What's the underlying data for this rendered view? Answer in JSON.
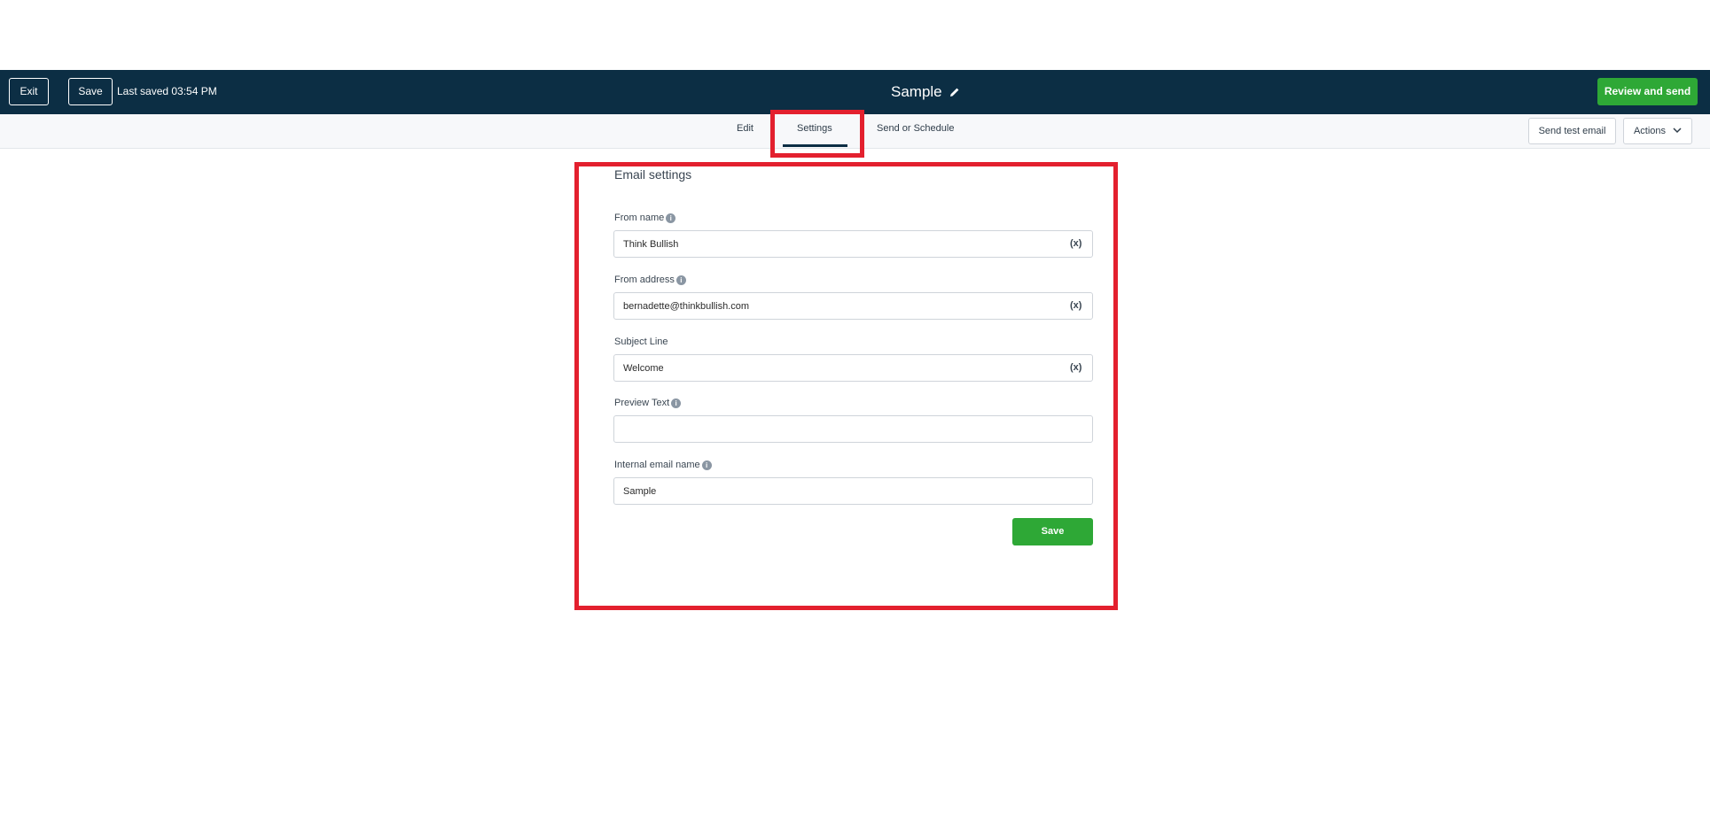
{
  "header": {
    "exit_label": "Exit",
    "save_label": "Save",
    "last_saved": "Last saved 03:54 PM",
    "title": "Sample",
    "review_label": "Review and send"
  },
  "tabs": [
    {
      "label": "Edit"
    },
    {
      "label": "Settings"
    },
    {
      "label": "Send or Schedule"
    }
  ],
  "toolbar": {
    "send_test_label": "Send test email",
    "actions_label": "Actions"
  },
  "settings": {
    "title": "Email settings",
    "from_name": {
      "label": "From name",
      "value": "Think Bullish"
    },
    "from_address": {
      "label": "From address",
      "value": "bernadette@thinkbullish.com"
    },
    "subject_line": {
      "label": "Subject Line",
      "value": "Welcome"
    },
    "preview_text": {
      "label": "Preview Text",
      "value": ""
    },
    "internal_name": {
      "label": "Internal email name",
      "value": "Sample"
    },
    "variable_glyph": "(x)",
    "save_label": "Save"
  },
  "colors": {
    "nav": "#0c2e44",
    "accent_green": "#2ea836",
    "highlight_red": "#e3202e"
  }
}
